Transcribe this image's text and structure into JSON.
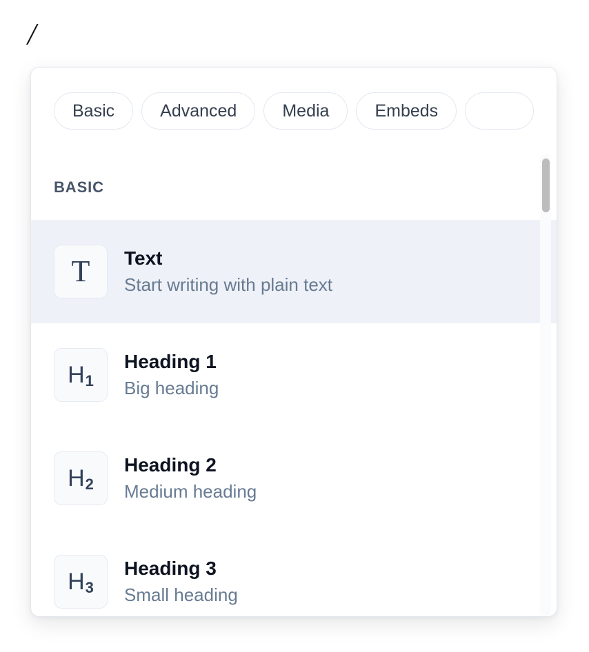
{
  "editor": {
    "typed_text": "/"
  },
  "popup": {
    "tabs": [
      {
        "label": "Basic",
        "active": true
      },
      {
        "label": "Advanced",
        "active": false
      },
      {
        "label": "Media",
        "active": false
      },
      {
        "label": "Embeds",
        "active": false
      },
      {
        "label": "",
        "active": false
      }
    ],
    "sections": [
      {
        "header": "BASIC",
        "items": [
          {
            "icon": "text-t-icon",
            "icon_glyph": "T",
            "icon_sub": "",
            "title": "Text",
            "description": "Start writing with plain text",
            "selected": true
          },
          {
            "icon": "heading-1-icon",
            "icon_glyph": "H",
            "icon_sub": "1",
            "title": "Heading 1",
            "description": "Big heading",
            "selected": false
          },
          {
            "icon": "heading-2-icon",
            "icon_glyph": "H",
            "icon_sub": "2",
            "title": "Heading 2",
            "description": "Medium heading",
            "selected": false
          },
          {
            "icon": "heading-3-icon",
            "icon_glyph": "H",
            "icon_sub": "3",
            "title": "Heading 3",
            "description": "Small heading",
            "selected": false
          }
        ]
      }
    ]
  },
  "colors": {
    "panel_background": "#ffffff",
    "panel_border": "#e4e8ef",
    "selected_row": "#eef1f7",
    "title_text": "#0d1320",
    "description_text": "#677b92",
    "section_header_text": "#475569",
    "tab_text": "#35404f",
    "tab_border": "#e2e8f1",
    "icon_glyph": "#33415a",
    "icon_box_background": "#f8fafc",
    "scrollbar_thumb": "#bcbcbc"
  }
}
